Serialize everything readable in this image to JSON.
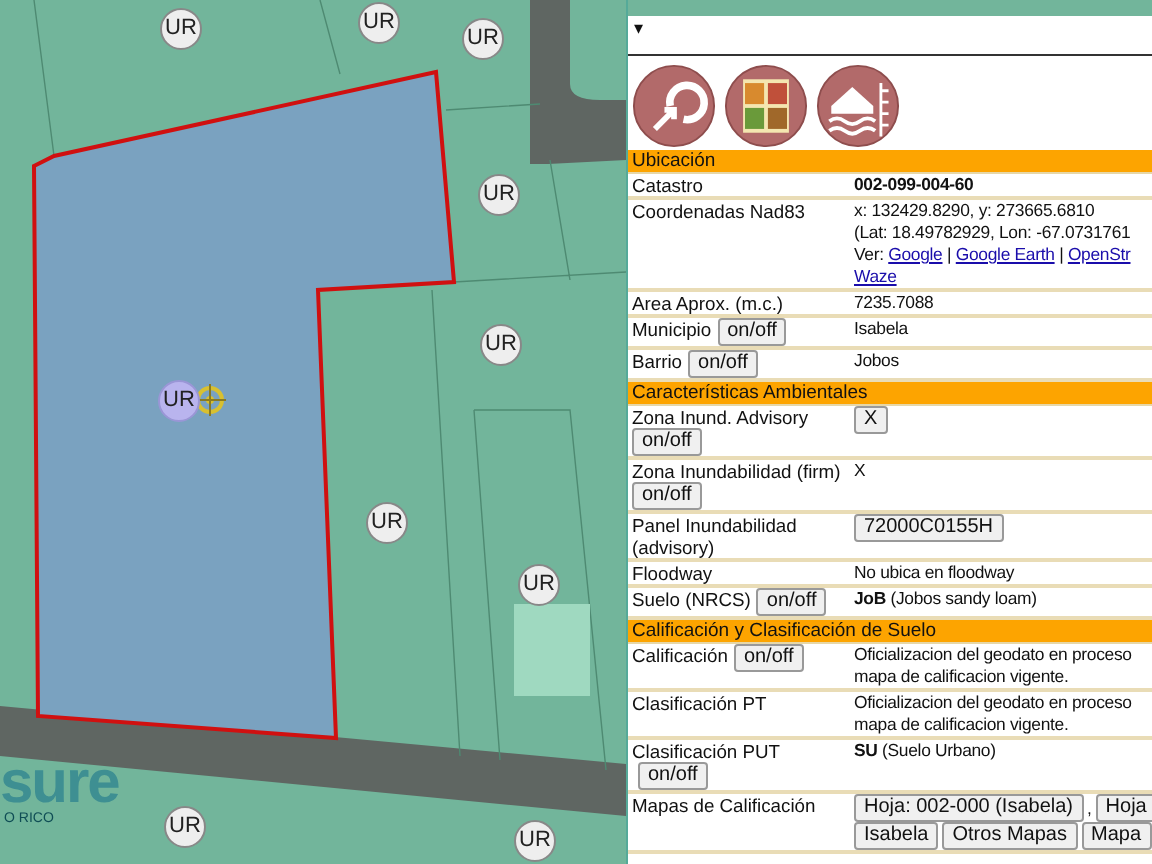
{
  "map": {
    "markers": [
      {
        "label": "UR",
        "selected": false
      },
      {
        "label": "UR",
        "selected": false
      },
      {
        "label": "UR",
        "selected": false
      },
      {
        "label": "UR",
        "selected": false
      },
      {
        "label": "UR",
        "selected": false
      },
      {
        "label": "UR",
        "selected": true
      },
      {
        "label": "UR",
        "selected": false
      },
      {
        "label": "UR",
        "selected": false
      },
      {
        "label": "UR",
        "selected": false
      },
      {
        "label": "UR",
        "selected": false
      }
    ],
    "logo": {
      "word": "sure",
      "tagline": "O RICO"
    }
  },
  "panel": {
    "dropdown_caret": "▾",
    "sections": [
      {
        "title": "Ubicación",
        "rows": [
          {
            "label": "Catastro",
            "value": {
              "kind": "text",
              "text": "002-099-004-60",
              "bold": true
            }
          },
          {
            "label": "Coordenadas Nad83",
            "value": {
              "kind": "coords",
              "lines": [
                "x: 132429.8290, y: 273665.6810",
                "(Lat: 18.49782929, Lon: -67.0731761"
              ],
              "prefix": "Ver:",
              "separator": "|",
              "link_lines": [
                [
                  "Google",
                  "Google Earth",
                  "OpenStr"
                ],
                [
                  "Waze"
                ]
              ]
            }
          },
          {
            "label": "Area Aprox. (m.c.)",
            "value": {
              "kind": "text",
              "text": "7235.7088",
              "bold": false
            }
          },
          {
            "label": "Municipio",
            "toggle": "on/off",
            "value": {
              "kind": "text",
              "text": "Isabela",
              "bold": false
            }
          },
          {
            "label": "Barrio",
            "toggle": "on/off",
            "value": {
              "kind": "text",
              "text": "Jobos",
              "bold": false
            }
          }
        ]
      },
      {
        "title": "Características Ambientales",
        "rows": [
          {
            "label": "Zona Inund. Advisory",
            "toggle": "on/off",
            "value": {
              "kind": "button",
              "text": "X"
            }
          },
          {
            "label": "Zona Inundabilidad (firm)",
            "toggle": "on/off",
            "value": {
              "kind": "text",
              "text": "X",
              "bold": false
            }
          },
          {
            "label": "Panel Inundabilidad (advisory)",
            "value": {
              "kind": "button",
              "text": "72000C0155H"
            }
          },
          {
            "label": "Floodway",
            "value": {
              "kind": "text",
              "text": "No ubica en floodway",
              "bold": false
            }
          },
          {
            "label": "Suelo (NRCS)",
            "toggle": "on/off",
            "value": {
              "kind": "text",
              "text": "**JoB** (Jobos sandy loam)",
              "bold": false
            }
          }
        ]
      },
      {
        "title": "Calificación y Clasificación de Suelo",
        "rows": [
          {
            "label": "Calificación",
            "toggle": "on/off",
            "value": {
              "kind": "lines",
              "lines": [
                "Oficializacion del geodato en proceso",
                "mapa de calificacion vigente."
              ]
            }
          },
          {
            "label": "Clasificación PT",
            "value": {
              "kind": "lines",
              "lines": [
                "Oficializacion del geodato en proceso",
                "mapa de calificacion vigente."
              ]
            }
          },
          {
            "label": "Clasificación PUT",
            "toggle": "on/off",
            "value": {
              "kind": "text",
              "text": "**SU** (Suelo Urbano)",
              "bold": false
            }
          },
          {
            "label": "Mapas de Calificación",
            "value": {
              "kind": "buttons",
              "lines": [
                [
                  {
                    "kind": "button",
                    "text": "Hoja: 002-000 (Isabela)"
                  },
                  {
                    "kind": "text",
                    "text": ","
                  },
                  {
                    "kind": "button",
                    "text": "Hoja"
                  }
                ],
                [
                  {
                    "kind": "button",
                    "text": "Isabela"
                  },
                  {
                    "kind": "button",
                    "text": "Otros Mapas"
                  },
                  {
                    "kind": "button",
                    "text": "Mapa"
                  }
                ]
              ]
            }
          }
        ]
      }
    ]
  }
}
